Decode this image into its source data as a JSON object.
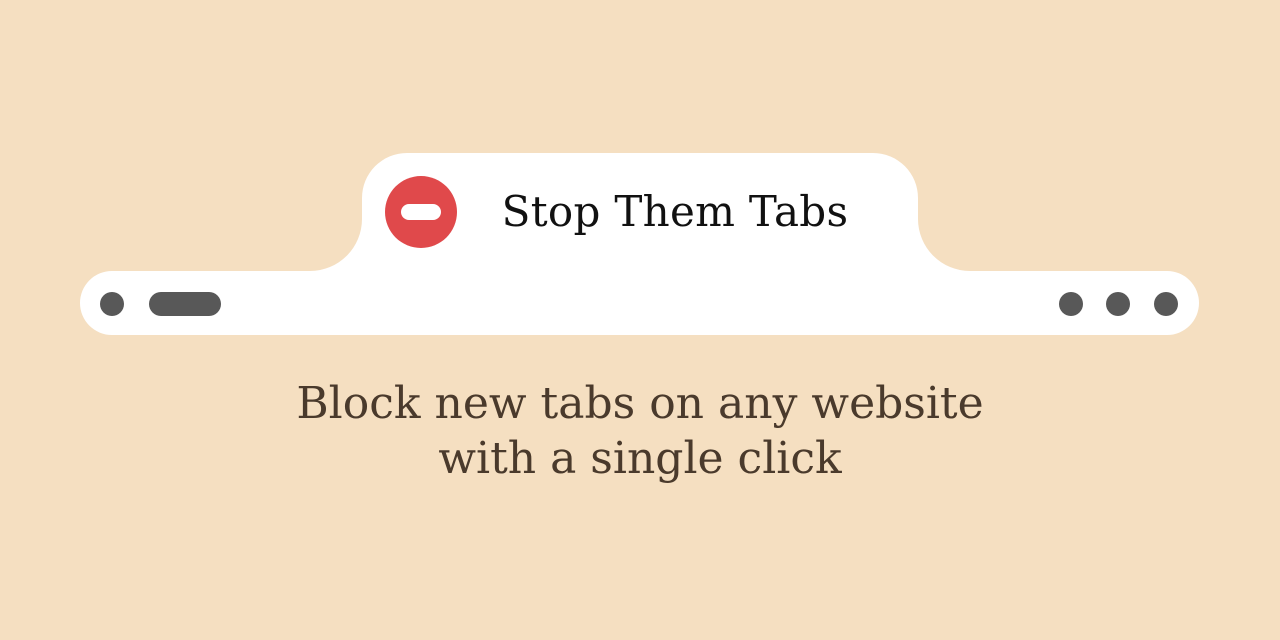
{
  "colors": {
    "background": "#F5DFC1",
    "window": "#FFFFFF",
    "block_icon": "#E0494B",
    "controls": "#585858",
    "tagline_text": "#4A3A2C"
  },
  "tab": {
    "icon": "no-entry-icon",
    "title": "Stop Them Tabs"
  },
  "toolbar": {
    "left_controls": [
      "dot-icon",
      "pill-icon"
    ],
    "right_controls": [
      "dot-icon",
      "dot-icon",
      "dot-icon"
    ]
  },
  "tagline": {
    "line1": "Block new tabs on any website",
    "line2": "with a single click"
  }
}
